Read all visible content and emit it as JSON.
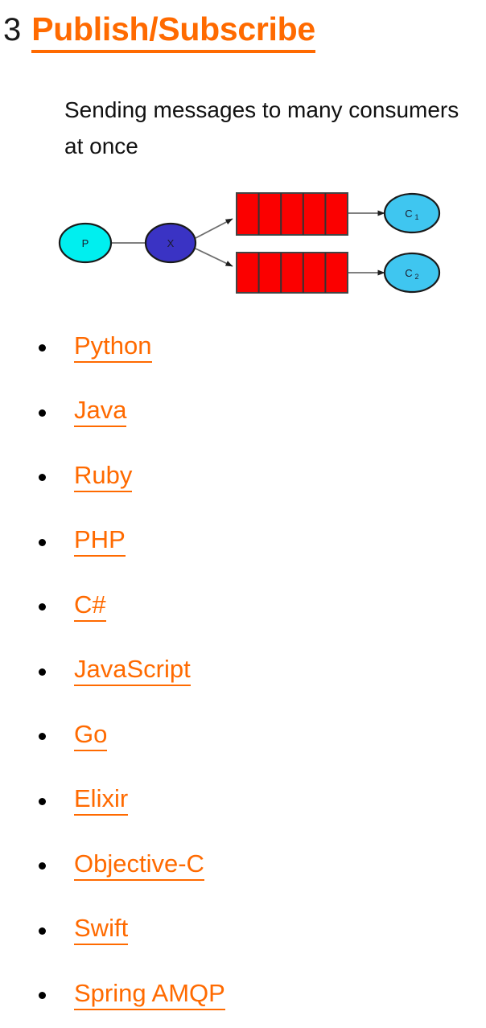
{
  "heading": {
    "number": "3",
    "title": "Publish/Subscribe",
    "color": "#ff6a00",
    "number_color": "#1a1a1a"
  },
  "subtitle": {
    "text": "Sending messages to many consumers at once",
    "color": "#111111"
  },
  "diagram": {
    "alt": "publish-subscribe-flow-diagram",
    "colors": {
      "producer_fill": "#00efef",
      "exchange_fill": "#3a33c4",
      "queue_fill": "#fb0000",
      "consumer_fill": "#3fc6f0",
      "stroke": "#1a1a1a",
      "arrow": "#555555"
    },
    "nodes": [
      {
        "id": "producer",
        "label": "P",
        "type": "ellipse"
      },
      {
        "id": "exchange",
        "label": "X",
        "type": "ellipse"
      },
      {
        "id": "queue-1",
        "label": "",
        "type": "queue",
        "cells": 5
      },
      {
        "id": "queue-2",
        "label": "",
        "type": "queue",
        "cells": 5
      },
      {
        "id": "consumer-1",
        "label": "C",
        "sub": "1",
        "type": "ellipse"
      },
      {
        "id": "consumer-2",
        "label": "C",
        "sub": "2",
        "type": "ellipse"
      }
    ],
    "edges": [
      {
        "from": "producer",
        "to": "exchange"
      },
      {
        "from": "exchange",
        "to": "queue-1"
      },
      {
        "from": "exchange",
        "to": "queue-2"
      },
      {
        "from": "queue-1",
        "to": "consumer-1"
      },
      {
        "from": "queue-2",
        "to": "consumer-2"
      }
    ]
  },
  "languages": [
    {
      "label": "Python"
    },
    {
      "label": "Java"
    },
    {
      "label": "Ruby"
    },
    {
      "label": "PHP"
    },
    {
      "label": "C#"
    },
    {
      "label": "JavaScript"
    },
    {
      "label": "Go"
    },
    {
      "label": "Elixir"
    },
    {
      "label": "Objective-C"
    },
    {
      "label": "Swift"
    },
    {
      "label": "Spring AMQP"
    }
  ]
}
